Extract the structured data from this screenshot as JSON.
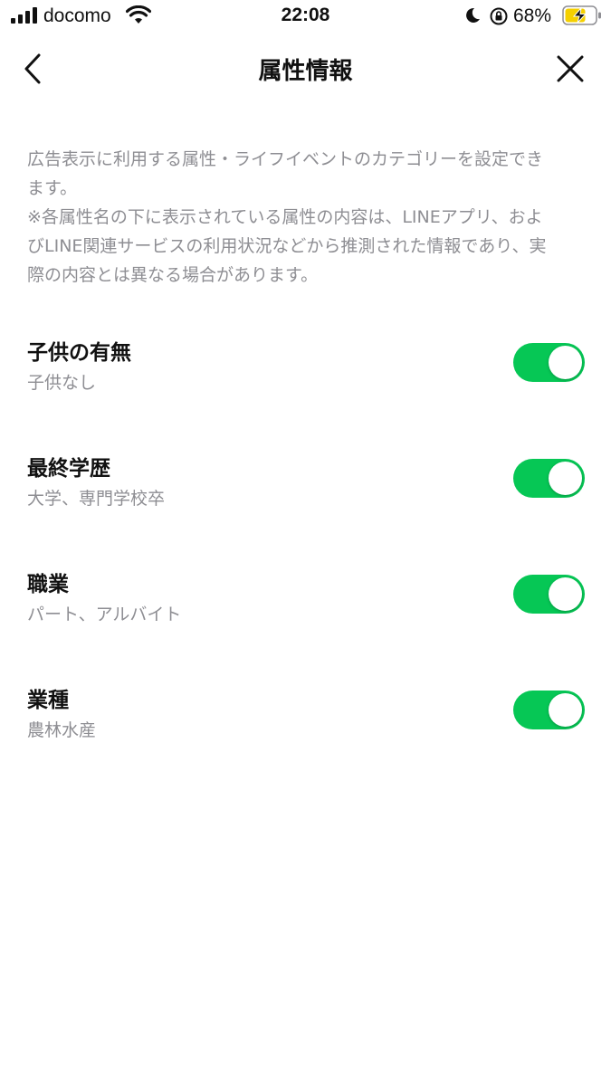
{
  "status_bar": {
    "carrier": "docomo",
    "time": "22:08",
    "battery_percent": "68%"
  },
  "nav": {
    "title": "属性情報"
  },
  "description": "広告表示に利用する属性・ライフイベントのカテゴリーを設定でき\nます。\n※各属性名の下に表示されている属性の内容は、LINEアプリ、およ\nびLINE関連サービスの利用状況などから推測された情報であり、実\n際の内容とは異なる場合があります。",
  "settings": [
    {
      "title": "子供の有無",
      "value": "子供なし",
      "enabled": true
    },
    {
      "title": "最終学歴",
      "value": "大学、専門学校卒",
      "enabled": true
    },
    {
      "title": "職業",
      "value": "パート、アルバイト",
      "enabled": true
    },
    {
      "title": "業種",
      "value": "農林水産",
      "enabled": true
    }
  ],
  "colors": {
    "toggle_on": "#06c755",
    "secondary_text": "#8e8e93",
    "battery_charging": "#f5d000"
  }
}
